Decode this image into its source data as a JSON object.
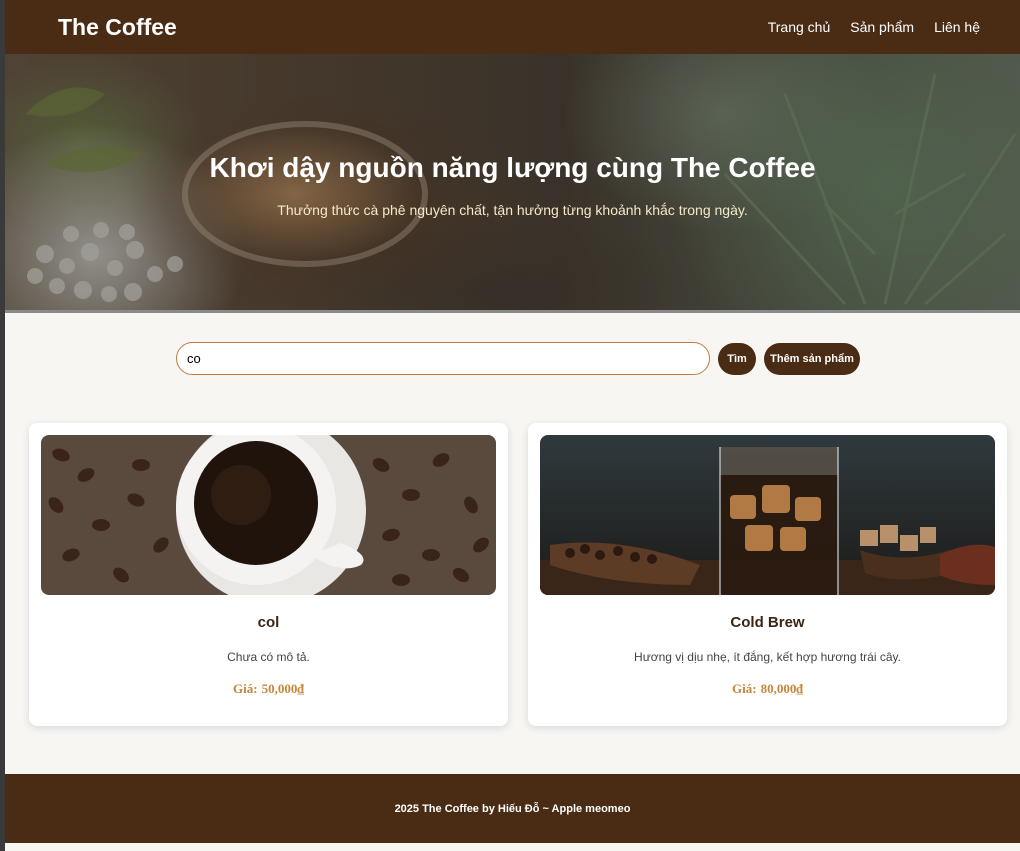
{
  "header": {
    "brand": "The Coffee",
    "nav": [
      {
        "label": "Trang chủ"
      },
      {
        "label": "Sản phẩm"
      },
      {
        "label": "Liên hệ"
      }
    ]
  },
  "hero": {
    "title": "Khơi dậy nguồn năng lượng cùng The Coffee",
    "subtitle": "Thưởng thức cà phê nguyên chất, tận hưởng từng khoảnh khắc trong ngày."
  },
  "search": {
    "value": "co",
    "search_button": "Tìm",
    "add_button": "Thêm sản phẩm"
  },
  "products": [
    {
      "name": "col",
      "description": "Chưa có mô tả.",
      "price_label": "Giá:",
      "price": "50,000₫"
    },
    {
      "name": "Cold Brew",
      "description": "Hương vị dịu nhẹ, ít đắng, kết hợp hương trái cây.",
      "price_label": "Giá:",
      "price": "80,000₫"
    }
  ],
  "footer": {
    "text": "2025 The Coffee by Hiếu Đỗ ~ Apple meomeo"
  },
  "colors": {
    "brand_brown": "#4a2c15",
    "price_gold": "#c5883a",
    "input_border": "#c47a3a"
  }
}
